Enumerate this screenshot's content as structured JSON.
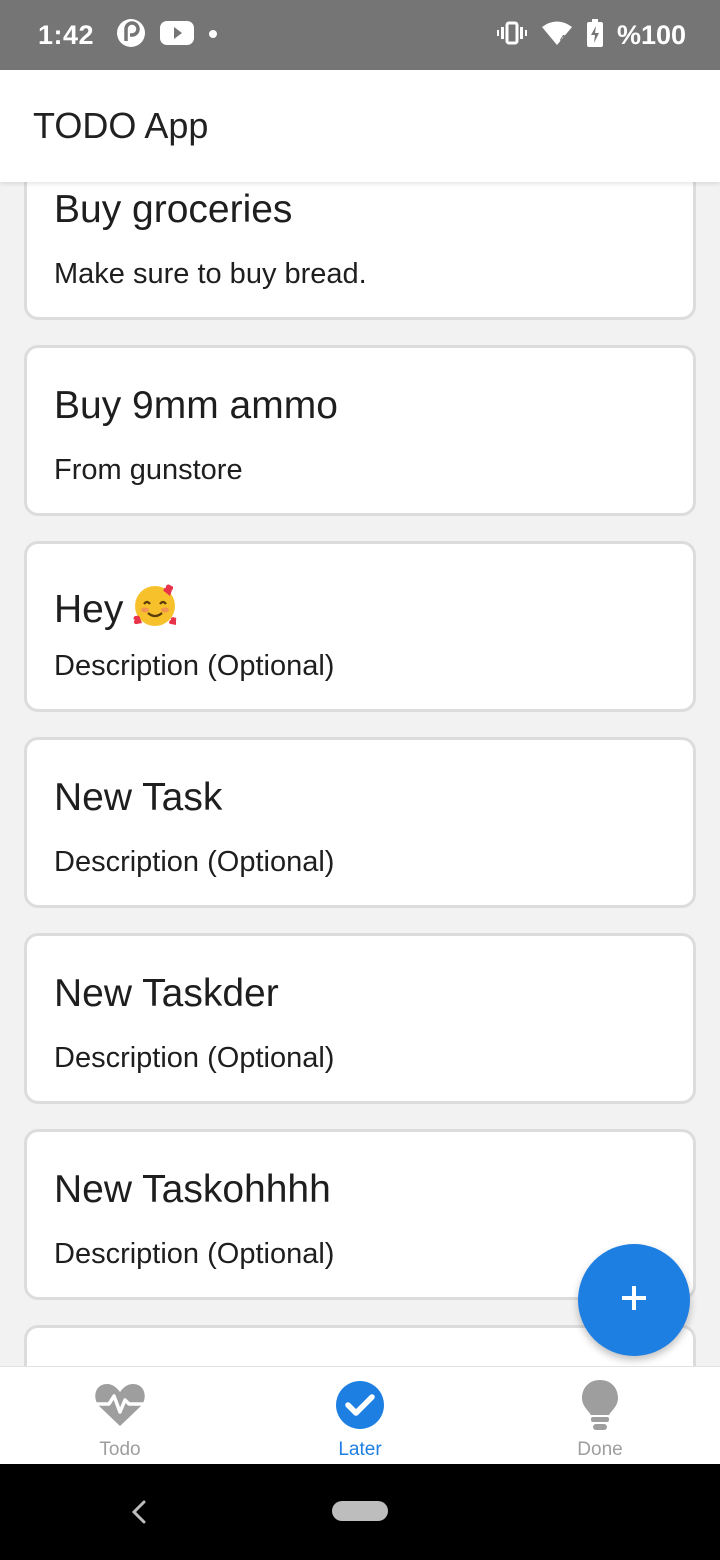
{
  "status_bar": {
    "time": "1:42",
    "icons_left": [
      "pocket-casts-icon",
      "youtube-icon",
      "dot-icon"
    ],
    "icons_right": [
      "vibrate-icon",
      "wifi-icon",
      "battery-charging-icon"
    ],
    "battery": "%100"
  },
  "app_bar": {
    "title": "TODO App"
  },
  "tasks": [
    {
      "title": "Buy groceries",
      "description": "Make sure to buy bread."
    },
    {
      "title": "Buy 9mm ammo",
      "description": "From gunstore"
    },
    {
      "title": "Hey",
      "emoji": "🥰",
      "description": "Description (Optional)"
    },
    {
      "title": "New Task",
      "description": "Description (Optional)"
    },
    {
      "title": "New Taskder",
      "description": "Description (Optional)"
    },
    {
      "title": "New Taskohhhh",
      "description": "Description (Optional)"
    }
  ],
  "fab": {
    "icon": "plus-icon"
  },
  "bottom_nav": {
    "items": [
      {
        "label": "Todo",
        "icon": "heartbeat-icon",
        "active": false
      },
      {
        "label": "Later",
        "icon": "check-circle-icon",
        "active": true
      },
      {
        "label": "Done",
        "icon": "lightbulb-icon",
        "active": false
      }
    ]
  },
  "colors": {
    "accent": "#1e7fe2",
    "status_bar": "#757575",
    "inactive": "#9e9e9e",
    "background": "#f2f2f2"
  }
}
